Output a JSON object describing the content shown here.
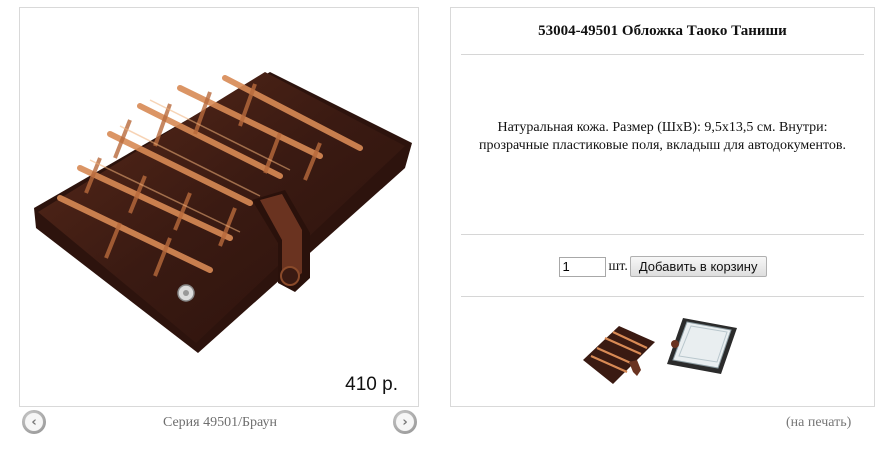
{
  "product": {
    "title": "53004-49501 Обложка Таоко Таниши",
    "price": "410 р.",
    "series": "Серия 49501/Браун",
    "description": "Натуральная кожа. Размер (ШхВ): 9,5х13,5 см. Внутри: прозрачные пластиковые поля, вкладыш для автодокументов."
  },
  "cart": {
    "quantity": "1",
    "unit_label": "шт.",
    "add_button_label": "Добавить в корзину"
  },
  "nav": {
    "prev_icon": "chevron-left-icon",
    "next_icon": "chevron-right-icon",
    "prev_glyph": "‹",
    "next_glyph": "›"
  },
  "print_link_label": "(на печать)",
  "colors": {
    "leather_dark": "#3a1a12",
    "leather_light": "#c87a4a",
    "border": "#d9d9d9",
    "muted_text": "#6e6e6e"
  }
}
